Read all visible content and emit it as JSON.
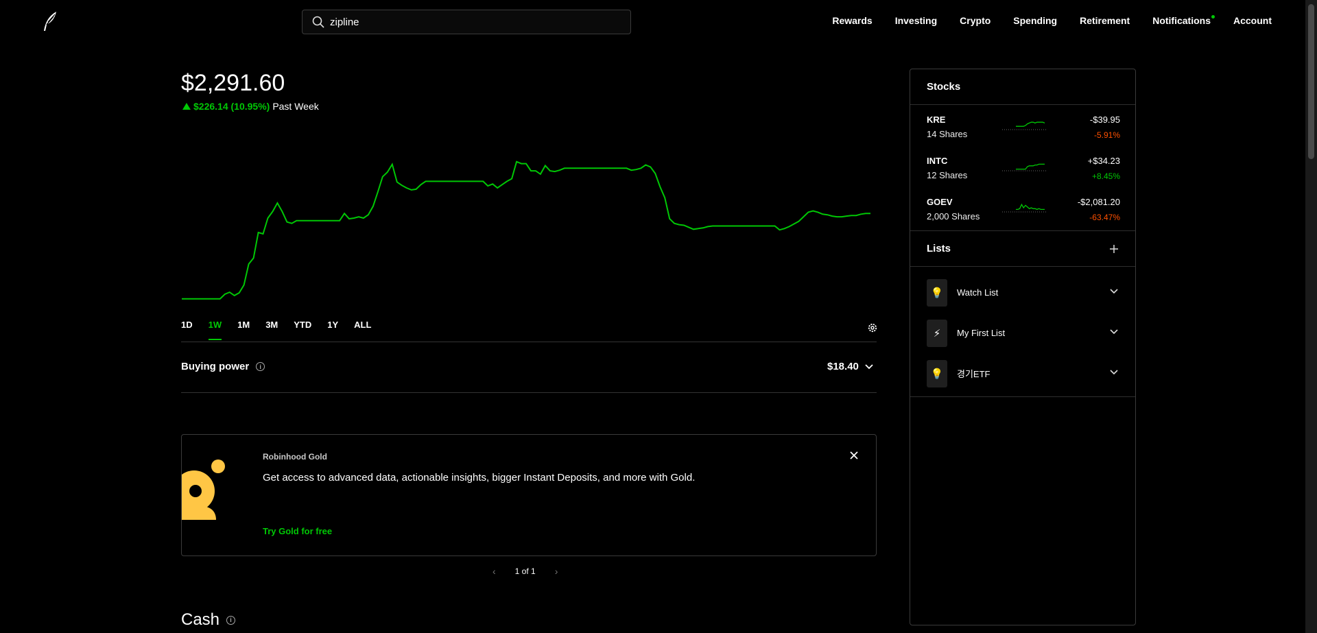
{
  "header": {
    "search_value": "zipline",
    "nav": [
      "Rewards",
      "Investing",
      "Crypto",
      "Spending",
      "Retirement"
    ],
    "notifications_label": "Notifications",
    "account_label": "Account"
  },
  "portfolio": {
    "value": "$2,291.60",
    "change": "$226.14 (10.95%)",
    "period": "Past Week",
    "ranges": [
      "1D",
      "1W",
      "1M",
      "3M",
      "YTD",
      "1Y",
      "ALL"
    ],
    "active_range": "1W",
    "accent_color": "#00c805"
  },
  "chart_data": {
    "type": "line",
    "series": [
      {
        "values": [
          2065,
          2065,
          2065,
          2065,
          2065,
          2065,
          2065,
          2065,
          2065,
          2072,
          2075,
          2070,
          2074,
          2086,
          2118,
          2127,
          2166,
          2164,
          2188,
          2198,
          2211,
          2198,
          2182,
          2180,
          2184,
          2184,
          2184,
          2184,
          2184,
          2184,
          2184,
          2184,
          2184,
          2184,
          2195,
          2187,
          2188,
          2190,
          2188,
          2193,
          2206,
          2228,
          2251,
          2258,
          2270,
          2243,
          2238,
          2234,
          2231,
          2232,
          2239,
          2244,
          2244,
          2244,
          2244,
          2244,
          2244,
          2244,
          2244,
          2244,
          2244,
          2244,
          2244,
          2244,
          2237,
          2240,
          2234,
          2239,
          2244,
          2248,
          2274,
          2271,
          2271,
          2260,
          2260,
          2255,
          2268,
          2260,
          2259,
          2261,
          2264,
          2264,
          2264,
          2264,
          2264,
          2264,
          2264,
          2264,
          2264,
          2264,
          2264,
          2264,
          2264,
          2264,
          2261,
          2262,
          2264,
          2269,
          2266,
          2256,
          2236,
          2219,
          2187,
          2180,
          2178,
          2177,
          2174,
          2171,
          2172,
          2173,
          2175,
          2176,
          2176,
          2176,
          2176,
          2176,
          2176,
          2176,
          2176,
          2176,
          2176,
          2176,
          2176,
          2176,
          2176,
          2170,
          2172,
          2175,
          2179,
          2183,
          2190,
          2197,
          2199,
          2197,
          2194,
          2193,
          2191,
          2190,
          2190,
          2191,
          2192,
          2192,
          2194,
          2195,
          2195
        ]
      }
    ]
  },
  "buying_power": {
    "label": "Buying power",
    "value": "$18.40"
  },
  "gold_card": {
    "eyebrow": "Robinhood Gold",
    "message": "Get access to advanced data, actionable insights, bigger Instant Deposits, and more with Gold.",
    "cta": "Try Gold for free",
    "pager": "1 of 1"
  },
  "cash": {
    "label": "Cash"
  },
  "sidebar": {
    "stocks_title": "Stocks",
    "stocks": [
      {
        "symbol": "KRE",
        "shares": "14 Shares",
        "amount": "-$39.95",
        "percent": "-5.91%",
        "direction": "down",
        "spark": [
          4,
          4,
          4,
          4,
          4,
          5,
          7,
          8,
          9,
          9,
          8,
          9,
          9,
          9,
          9,
          8
        ]
      },
      {
        "symbol": "INTC",
        "shares": "12 Shares",
        "amount": "+$34.23",
        "percent": "+8.45%",
        "direction": "up",
        "spark": [
          2,
          2,
          2,
          2,
          2,
          2,
          5,
          6,
          6,
          6,
          7,
          7,
          8,
          8,
          8,
          8
        ]
      },
      {
        "symbol": "GOEV",
        "shares": "2,000 Shares",
        "amount": "-$2,081.20",
        "percent": "-63.47%",
        "direction": "down",
        "spark": [
          3,
          3,
          4,
          9,
          5,
          8,
          6,
          4,
          5,
          4,
          4,
          3,
          4,
          3,
          3,
          3
        ]
      }
    ],
    "lists_title": "Lists",
    "lists": [
      {
        "name": "Watch List",
        "icon": "lightbulb-icon",
        "glyph": "💡"
      },
      {
        "name": "My First List",
        "icon": "lightning-icon",
        "glyph": "⚡"
      },
      {
        "name": "경기ETF",
        "icon": "lightbulb-icon",
        "glyph": "💡"
      }
    ]
  }
}
